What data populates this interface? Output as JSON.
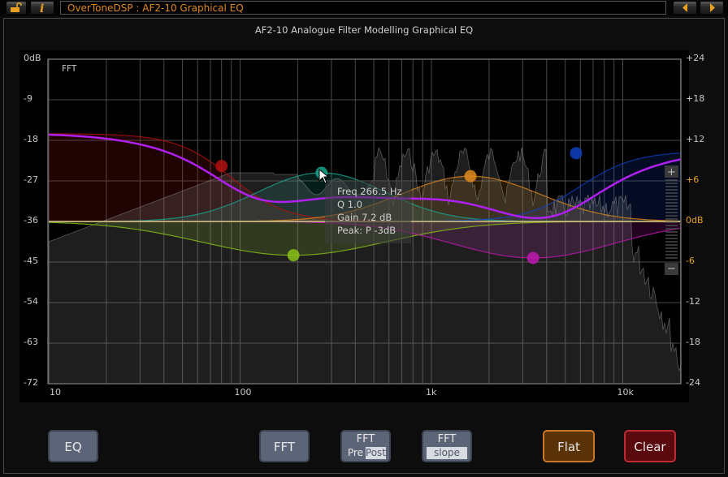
{
  "topbar": {
    "lock_icon": "unlocked-padlock-icon",
    "info_icon": "info-icon",
    "title": "OverToneDSP  :  AF2-10  Graphical EQ",
    "prev_icon": "arrow-left-icon",
    "next_icon": "arrow-right-icon"
  },
  "panel": {
    "title": "AF2-10 Analogue Filter Modelling Graphical EQ"
  },
  "graph": {
    "fft_label": "FFT",
    "left_axis": [
      "0dB",
      "-9",
      "-18",
      "-27",
      "-36",
      "-45",
      "-54",
      "-63",
      "-72"
    ],
    "right_axis": [
      "+24",
      "+18",
      "+12",
      "+6",
      "0dB",
      "-6",
      "-12",
      "-18",
      "-24"
    ],
    "right_axis_highlight": [
      "+6",
      "0dB",
      "-6"
    ],
    "freq_axis": [
      "10",
      "100",
      "1k",
      "10k"
    ],
    "zoom_in_label": "+",
    "zoom_out_label": "−",
    "tooltip": {
      "freq": "Freq 266.5 Hz",
      "q": "Q 1.0",
      "gain": "Gain 7.2 dB",
      "peak": "Peak: P -3dB"
    },
    "bands": [
      {
        "name": "low-shelf",
        "color": "#b01010",
        "freq_hz": 80,
        "gain_db": 8.2
      },
      {
        "name": "low-peak",
        "color": "#8ac218",
        "freq_hz": 190,
        "gain_db": -5.0
      },
      {
        "name": "mid-peak",
        "color": "#1aa58e",
        "freq_hz": 266.5,
        "gain_db": 7.2,
        "q": 1.0,
        "selected": true
      },
      {
        "name": "high-mid-peak",
        "color": "#e08a1e",
        "freq_hz": 1600,
        "gain_db": 6.7
      },
      {
        "name": "presence-peak",
        "color": "#c018b0",
        "freq_hz": 3400,
        "gain_db": -5.4
      },
      {
        "name": "high-shelf",
        "color": "#1040c0",
        "freq_hz": 5700,
        "gain_db": 10.1
      }
    ],
    "colors": {
      "sum_curve": "#b020f0",
      "grid": "#5a5a5a",
      "axis_highlight": "#e8a020"
    }
  },
  "buttons": {
    "eq": "EQ",
    "fft": "FFT",
    "fft_prepost_top": "FFT",
    "fft_pre": "Pre",
    "fft_post": "Post",
    "fft_slope_top": "FFT",
    "fft_slope": "slope",
    "flat": "Flat",
    "clear": "Clear"
  }
}
